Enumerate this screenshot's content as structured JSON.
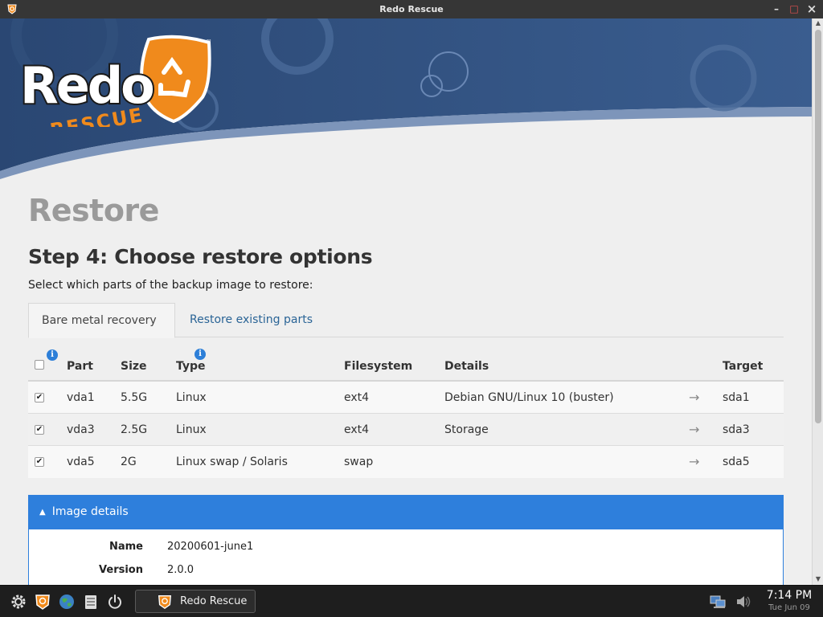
{
  "window": {
    "title": "Redo Rescue",
    "minimize_glyph": "–",
    "maximize_glyph": "□",
    "close_glyph": "×"
  },
  "banner": {
    "logo_word": "Redo",
    "logo_sub": "RESCUE",
    "trademark": "™"
  },
  "page": {
    "title": "Restore",
    "step_title": "Step 4: Choose restore options",
    "subtitle": "Select which parts of the backup image to restore:"
  },
  "tabs": [
    {
      "label": "Bare metal recovery",
      "active": true,
      "info_icon": "info-icon"
    },
    {
      "label": "Restore existing parts",
      "active": false,
      "info_icon": "info-icon"
    }
  ],
  "table": {
    "headers": {
      "part": "Part",
      "size": "Size",
      "type": "Type",
      "filesystem": "Filesystem",
      "details": "Details",
      "target": "Target"
    },
    "header_checked": false,
    "rows": [
      {
        "checked": true,
        "part": "vda1",
        "size": "5.5G",
        "type": "Linux",
        "filesystem": "ext4",
        "details": "Debian GNU/Linux 10 (buster)",
        "arrow": "→",
        "target": "sda1"
      },
      {
        "checked": true,
        "part": "vda3",
        "size": "2.5G",
        "type": "Linux",
        "filesystem": "ext4",
        "details": "Storage",
        "arrow": "→",
        "target": "sda3"
      },
      {
        "checked": true,
        "part": "vda5",
        "size": "2G",
        "type": "Linux swap / Solaris",
        "filesystem": "swap",
        "details": "",
        "arrow": "→",
        "target": "sda5"
      }
    ]
  },
  "image_details": {
    "heading": "Image details",
    "fields": [
      {
        "key": "Name",
        "value": "20200601-june1"
      },
      {
        "key": "Version",
        "value": "2.0.0"
      }
    ]
  },
  "taskbar": {
    "task_label": "Redo Rescue",
    "time": "7:14 PM",
    "date": "Tue Jun 09",
    "icons": [
      "settings-gear-icon",
      "redo-rescue-icon",
      "globe-icon",
      "file-manager-icon",
      "power-icon",
      "network-icon",
      "volume-icon"
    ]
  },
  "colors": {
    "accent": "#2e7fdc",
    "banner_dark": "#2c4a78",
    "logo_orange": "#f08a1c",
    "title_gray": "#9a9a9a"
  }
}
